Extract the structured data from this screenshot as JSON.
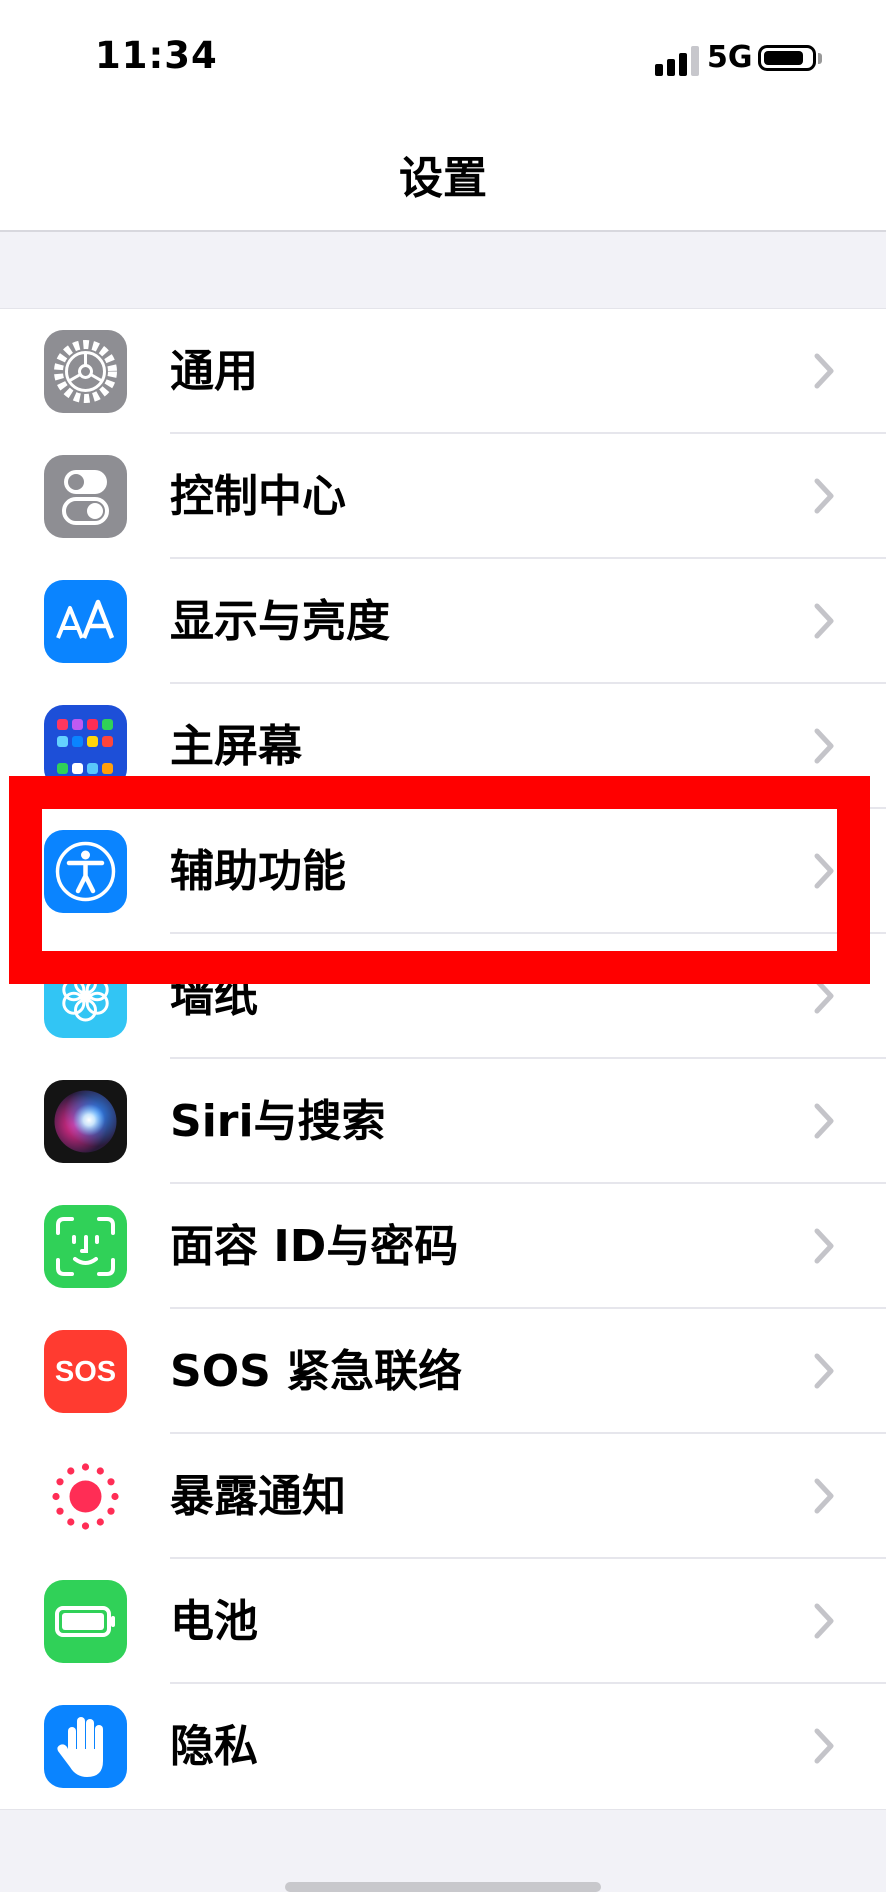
{
  "status_bar": {
    "time": "11:34",
    "network": "5G",
    "battery_level": 0.85
  },
  "navbar": {
    "title": "设置"
  },
  "settings": [
    {
      "label": "通用",
      "icon": "gear-icon",
      "color": "#8e8e93"
    },
    {
      "label": "控制中心",
      "icon": "toggles-icon",
      "color": "#8e8e93"
    },
    {
      "label": "显示与亮度",
      "icon": "text-size-icon",
      "color": "#0a84ff"
    },
    {
      "label": "主屏幕",
      "icon": "home-grid-icon",
      "color": "#1d4fd8"
    },
    {
      "label": "辅助功能",
      "icon": "accessibility-icon",
      "color": "#0a84ff"
    },
    {
      "label": "墙纸",
      "icon": "flower-icon",
      "color": "#32c5f4"
    },
    {
      "label": "Siri与搜索",
      "icon": "siri-icon",
      "color": "#141414"
    },
    {
      "label": "面容 ID与密码",
      "icon": "face-id-icon",
      "color": "#30d158"
    },
    {
      "label": "SOS 紧急联络",
      "icon": "sos-icon",
      "color": "#ff3b30",
      "icon_text": "SOS"
    },
    {
      "label": "暴露通知",
      "icon": "exposure-icon",
      "color": "#ffffff"
    },
    {
      "label": "电池",
      "icon": "battery-icon",
      "color": "#30d158"
    },
    {
      "label": "隐私",
      "icon": "hand-icon",
      "color": "#0a84ff"
    }
  ],
  "highlight": {
    "target": "辅助功能",
    "color": "#ff0000"
  }
}
